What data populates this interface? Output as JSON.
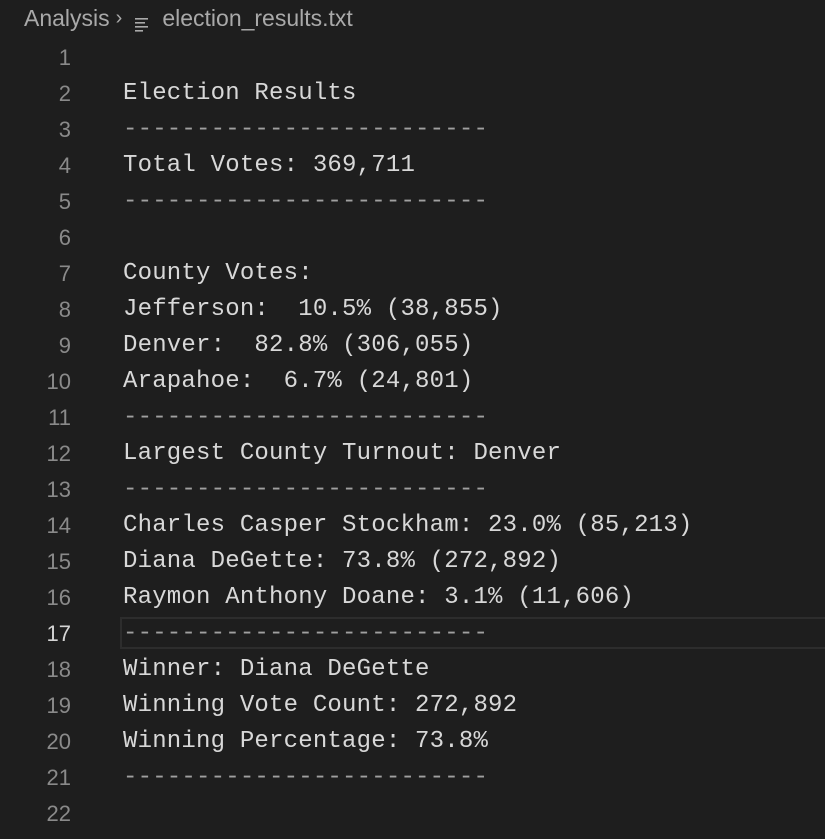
{
  "breadcrumb": {
    "folder": "Analysis",
    "chevron_icon": "chevron-right-icon",
    "file_icon": "text-file-icon",
    "file": "election_results.txt"
  },
  "editor": {
    "current_line": 17,
    "lines": [
      {
        "n": "1",
        "text": ""
      },
      {
        "n": "2",
        "text": "Election Results"
      },
      {
        "n": "3",
        "text": "-------------------------"
      },
      {
        "n": "4",
        "text": "Total Votes: 369,711"
      },
      {
        "n": "5",
        "text": "-------------------------"
      },
      {
        "n": "6",
        "text": ""
      },
      {
        "n": "7",
        "text": "County Votes:"
      },
      {
        "n": "8",
        "text": "Jefferson:  10.5% (38,855)"
      },
      {
        "n": "9",
        "text": "Denver:  82.8% (306,055)"
      },
      {
        "n": "10",
        "text": "Arapahoe:  6.7% (24,801)"
      },
      {
        "n": "11",
        "text": "-------------------------"
      },
      {
        "n": "12",
        "text": "Largest County Turnout: Denver"
      },
      {
        "n": "13",
        "text": "-------------------------"
      },
      {
        "n": "14",
        "text": "Charles Casper Stockham: 23.0% (85,213)"
      },
      {
        "n": "15",
        "text": "Diana DeGette: 73.8% (272,892)"
      },
      {
        "n": "16",
        "text": "Raymon Anthony Doane: 3.1% (11,606)"
      },
      {
        "n": "17",
        "text": "-------------------------"
      },
      {
        "n": "18",
        "text": "Winner: Diana DeGette"
      },
      {
        "n": "19",
        "text": "Winning Vote Count: 272,892"
      },
      {
        "n": "20",
        "text": "Winning Percentage: 73.8%"
      },
      {
        "n": "21",
        "text": "-------------------------"
      },
      {
        "n": "22",
        "text": ""
      }
    ]
  }
}
